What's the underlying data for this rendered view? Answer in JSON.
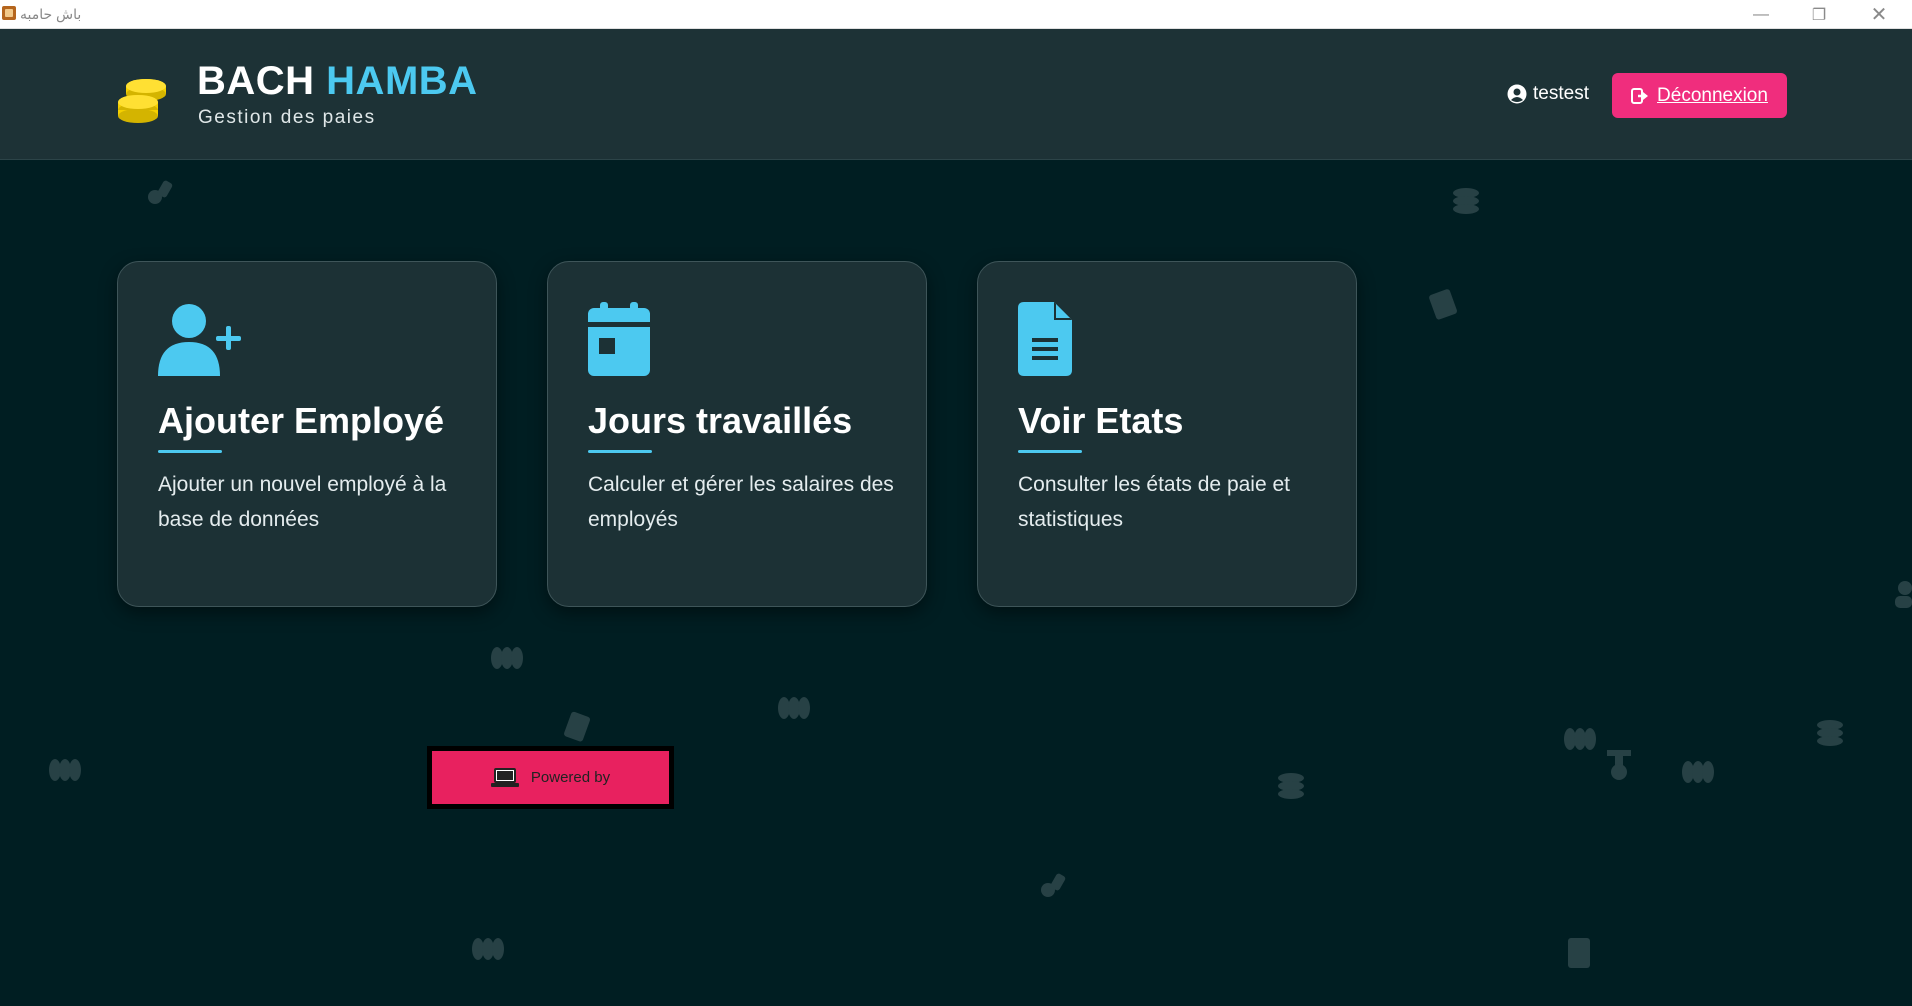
{
  "window": {
    "title": "باش حامبه",
    "controls": [
      "minimize-icon",
      "restore-icon",
      "close-icon"
    ]
  },
  "header": {
    "brand_part1": "BACH",
    "brand_part2": "HAMBA",
    "subtitle": "Gestion des paies",
    "logo_icon": "coins-icon",
    "username": "testest",
    "logout_label": "Déconnexion"
  },
  "cards": [
    {
      "icon": "user-plus-icon",
      "title": "Ajouter Employé",
      "description": "Ajouter un nouvel employé à la base de données"
    },
    {
      "icon": "calendar-icon",
      "title": "Jours travaillés",
      "description": "Calculer et gérer les salaires des employés"
    },
    {
      "icon": "document-icon",
      "title": "Voir Etats",
      "description": "Consulter les états de paie et statistiques"
    }
  ],
  "footer": {
    "powered_label": "Powered by"
  },
  "colors": {
    "background": "#001e22",
    "header_bg": "#1d3236",
    "accent": "#4cc9f0",
    "logout": "#f02d7d",
    "powered": "#e8215f",
    "coin": "#f5d000"
  }
}
